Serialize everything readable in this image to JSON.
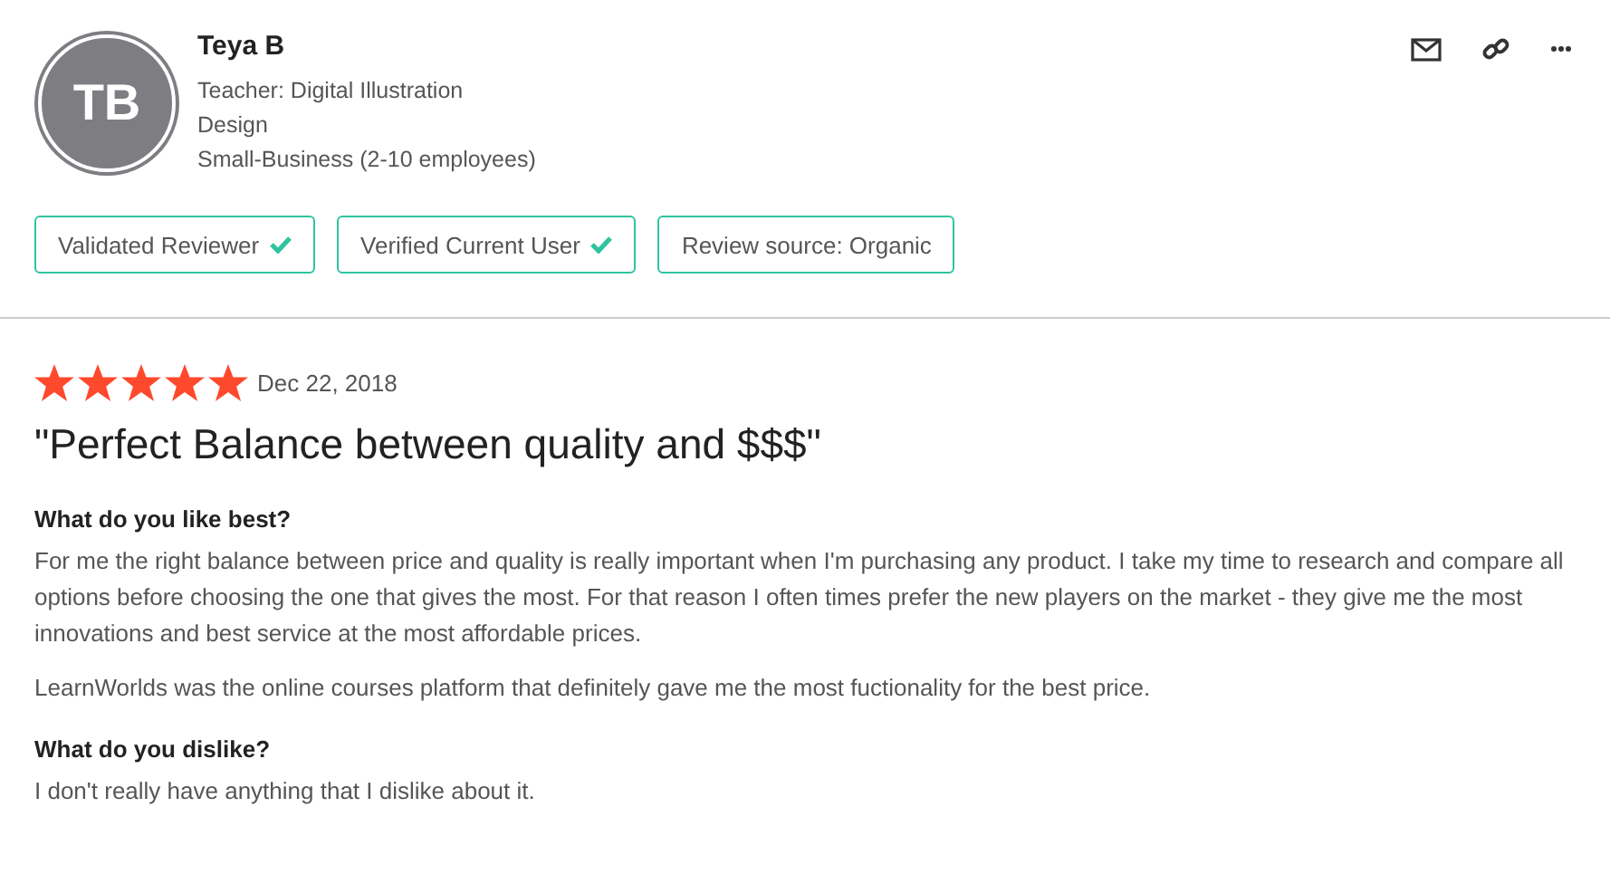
{
  "reviewer": {
    "initials": "TB",
    "name": "Teya B",
    "details": [
      "Teacher: Digital Illustration",
      "Design",
      "Small-Business (2-10 employees)"
    ]
  },
  "badges": [
    {
      "label": "Validated Reviewer",
      "checked": true
    },
    {
      "label": "Verified Current User",
      "checked": true
    },
    {
      "label": "Review source: Organic",
      "checked": false
    }
  ],
  "review": {
    "stars": 5,
    "date": "Dec 22, 2018",
    "title": "\"Perfect Balance between quality and $$$\"",
    "sections": [
      {
        "question": "What do you like best?",
        "paragraphs": [
          "For me the right balance between price and quality is really important when I'm purchasing any product. I take my time to research and compare all options before choosing the one that gives the most. For that reason I often times prefer the new players on the market - they give me the most innovations and best service at the most affordable prices.",
          "LearnWorlds was the online courses platform that definitely gave me the most fuctionality for the best price."
        ]
      },
      {
        "question": "What do you dislike?",
        "paragraphs": [
          "I don't really have anything that I dislike about it."
        ]
      }
    ]
  }
}
